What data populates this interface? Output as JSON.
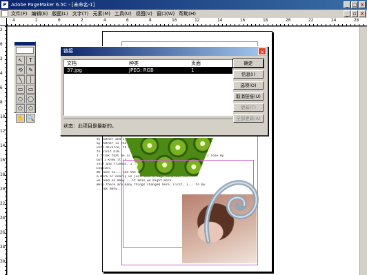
{
  "window": {
    "title": "Adobe PageMaker 6.5C - [未命名-1]",
    "app_icon": "pagemaker-logo-icon"
  },
  "menu": {
    "items": [
      "文件(F)",
      "编辑(E)",
      "版面(L)",
      "文字(T)",
      "元素(M)",
      "工具(U)",
      "视图(V)",
      "窗口(W)",
      "帮助(H)"
    ]
  },
  "ruler": {
    "top_numbers": [
      "4",
      "2",
      "0",
      "2",
      "4",
      "6",
      "8",
      "10",
      "12",
      "14",
      "16",
      "18",
      "20",
      "22",
      "24",
      "26"
    ],
    "left_numbers": [
      "2",
      "0",
      "2",
      "4",
      "6",
      "8",
      "10",
      "12",
      "14",
      "16",
      "18",
      "20",
      "22",
      "24",
      "26",
      "28",
      "30"
    ]
  },
  "toolbox": {
    "tools": [
      "↖",
      "T",
      "⟲",
      "✎",
      "╲",
      "│",
      "▭",
      "▭",
      "○",
      "◯",
      "⬠",
      "⬠",
      "✋",
      "🔍"
    ]
  },
  "dialog": {
    "title": "链接",
    "columns": [
      "文档",
      "种类",
      "页面"
    ],
    "rows": [
      {
        "doc": "37.jpg",
        "kind": "JPEG: RGB",
        "page": "1",
        "selected": true
      }
    ],
    "buttons": [
      {
        "label": "确定",
        "default": true,
        "disabled": false
      },
      {
        "label": "信息(I)",
        "default": false,
        "disabled": false
      },
      {
        "label": "选项(O)",
        "default": false,
        "disabled": false
      },
      {
        "label": "取消链接(U)",
        "default": false,
        "disabled": false
      },
      {
        "label": "更新(T)",
        "default": false,
        "disabled": true
      },
      {
        "label": "全部更新(A)",
        "default": false,
        "disabled": true
      }
    ],
    "status": "状态：此项目是最新的。"
  },
  "page_text": {
    "lines": [
      "                                               ty father and I do not want",
      "my father is                                   the woman who cannot go out",
      "with divorce,                                  th my father and I do not want",
      "to visit him.",
      "",
      "I think that he is not a good father. I love my family and I love my",
      "but I know it is      ...ble. First we are",
      "self and friends.  I        ...ngs went on in China.",
      "",
      "English.",
      "We have to... and the dad's life...",
      "a more or nearly us just like a huge surprise for                         ...",
      "we need no many ...it main we might more.",
      "",
      "Well there are many things changed here. First, I...                 to be",
      "...ngs many..."
    ]
  }
}
